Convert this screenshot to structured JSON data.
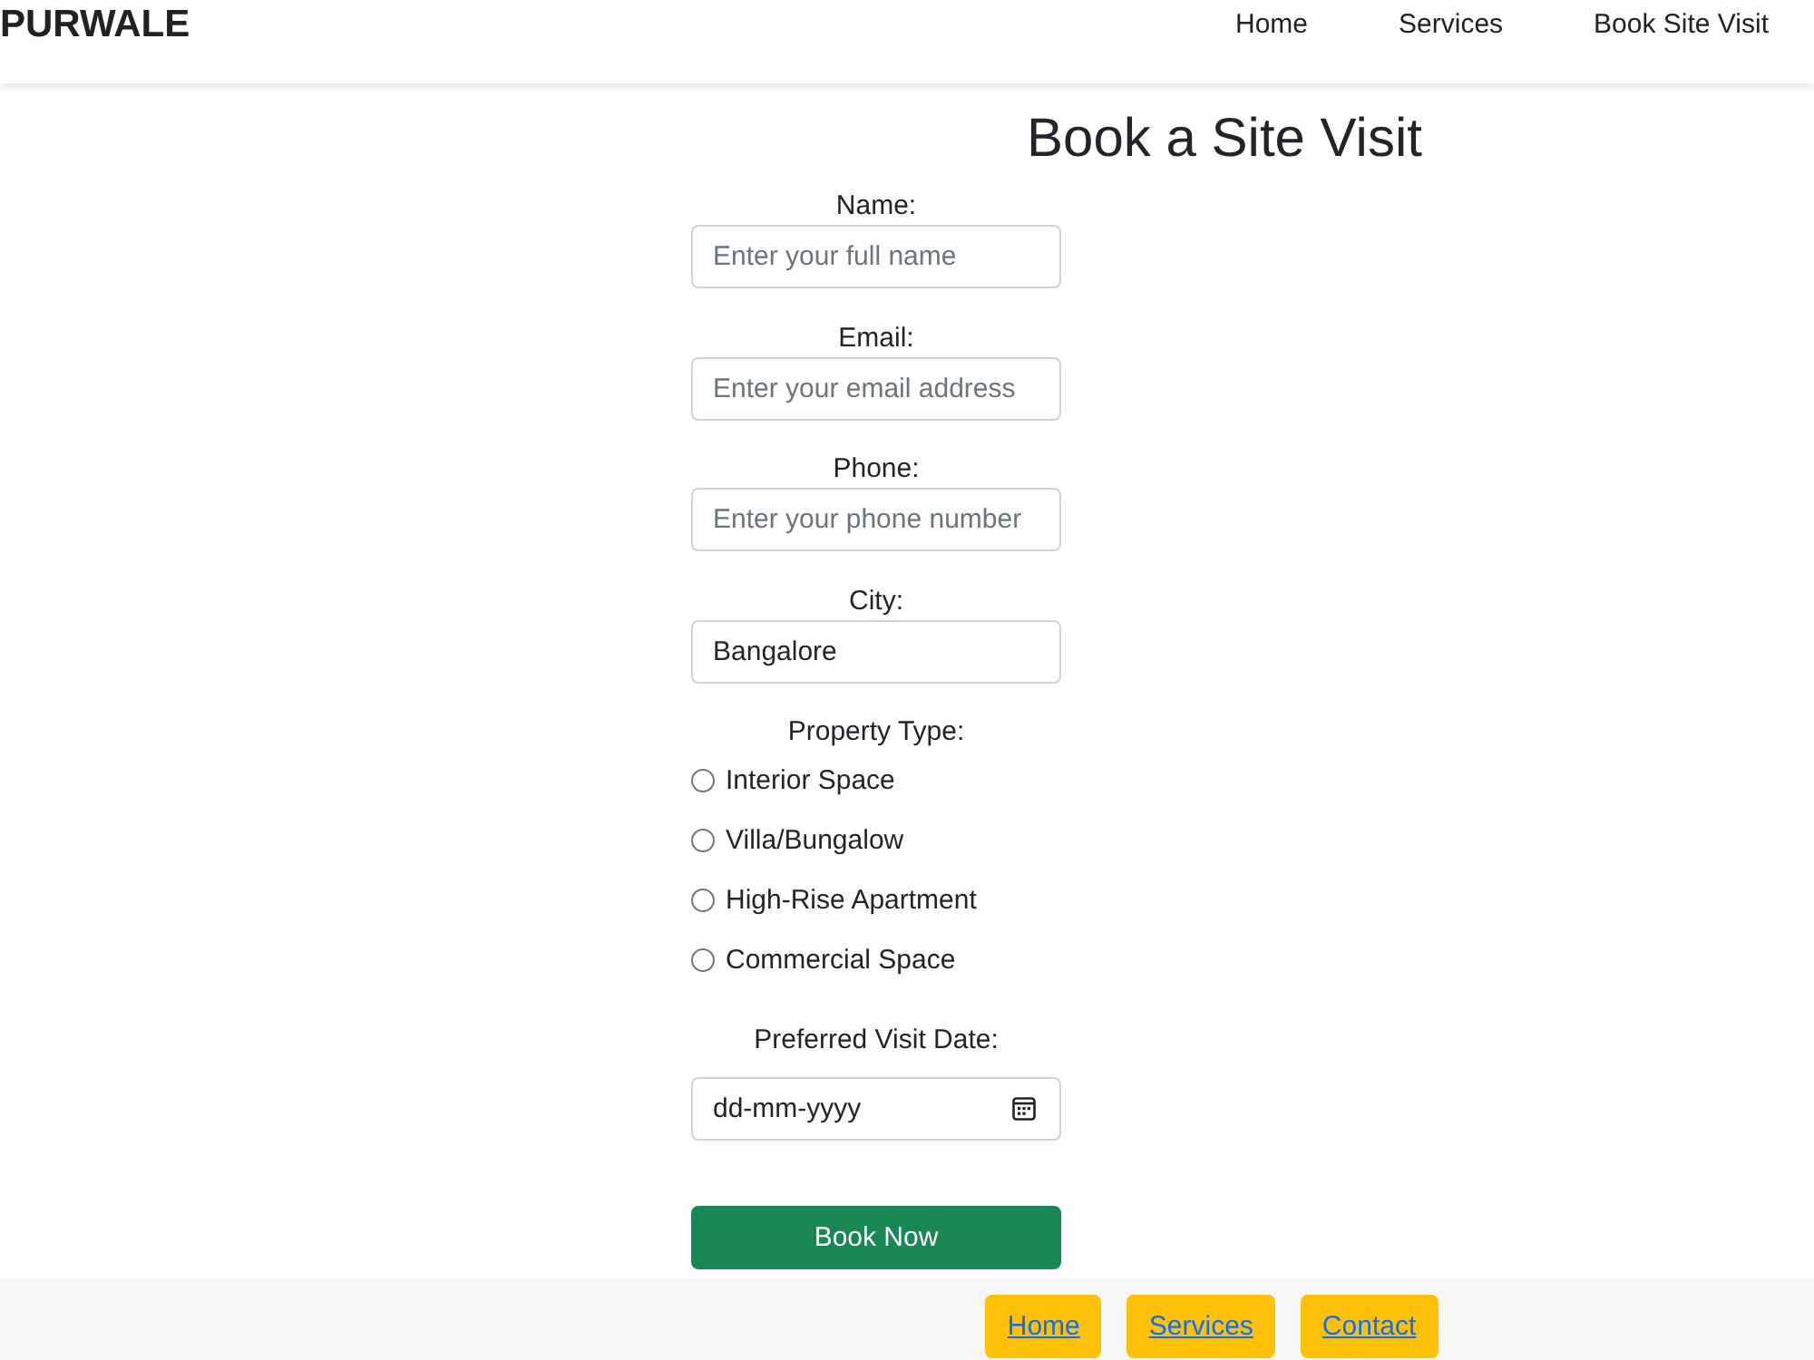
{
  "header": {
    "logo": "PURWALE",
    "nav": [
      "Home",
      "Services",
      "Book Site Visit"
    ]
  },
  "form": {
    "title": "Book a Site Visit",
    "fields": [
      {
        "label": "Name:",
        "placeholder": "Enter your full name"
      },
      {
        "label": "Email:",
        "placeholder": "Enter your email address"
      },
      {
        "label": "Phone:",
        "placeholder": "Enter your phone number"
      },
      {
        "label": "City:",
        "value": "Bangalore"
      }
    ],
    "property_type": {
      "label": "Property Type:",
      "options": [
        {
          "label": "Interior Space",
          "selected": false
        },
        {
          "label": "Villa/Bungalow",
          "selected": false
        },
        {
          "label": "High-Rise Apartment",
          "selected": false
        },
        {
          "label": "Commercial Space",
          "selected": false
        }
      ]
    },
    "visit_date": {
      "label": "Preferred Visit Date:",
      "placeholder": "dd-mm-yyyy"
    },
    "submit": "Book Now"
  },
  "footer": {
    "links": [
      "Home",
      "Services",
      "Contact"
    ]
  }
}
